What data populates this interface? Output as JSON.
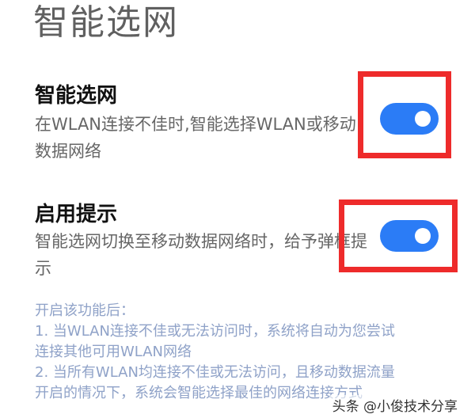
{
  "page": {
    "title": "智能选网"
  },
  "settings": [
    {
      "title": "智能选网",
      "description": "在WLAN连接不佳时,智能选择WLAN或移动数据网络",
      "enabled": true
    },
    {
      "title": "启用提示",
      "description": "智能选网切换至移动数据网络时，给予弹框提示",
      "enabled": true
    }
  ],
  "info": {
    "heading": "开启该功能后：",
    "line1": "1. 当WLAN连接不佳或无法访问时，系统将自动为您尝试",
    "line2": "连接其他可用WLAN网络",
    "line3": "2. 当所有WLAN均连接不佳或无法访问，且移动数据流量",
    "line4": "开启的情况下，系统会智能选择最佳的网络连接方式"
  },
  "watermark": "头条 @小俊技术分享",
  "colors": {
    "accent": "#2b7cf6",
    "highlight": "#ee2b2b",
    "info_text": "#8fa2c8"
  }
}
